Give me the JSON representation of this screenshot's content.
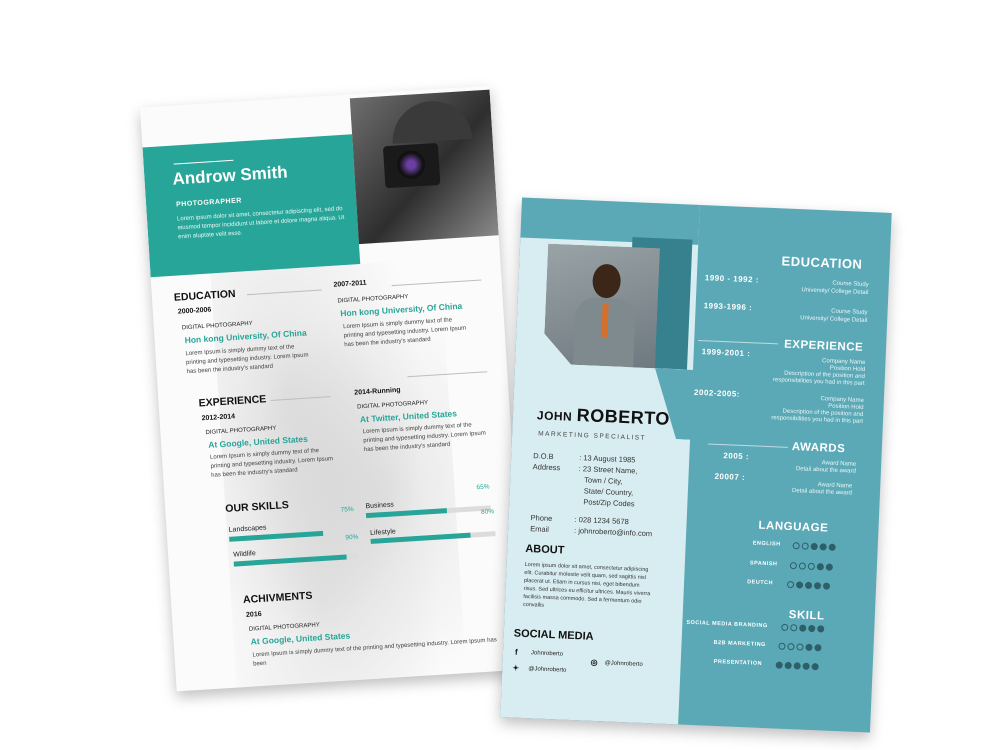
{
  "left": {
    "name": "Androw Smith",
    "role": "PHOTOGRAPHER",
    "intro": "Lorem ipsum dolor sit amet, consectetur adipiscing elit, sed do eiusmod tempor incididunt ut labore et dolore magna aliqua. Ut enim aluptate velit esse.",
    "education_heading": "EDUCATION",
    "education": [
      {
        "years": "2000-2006",
        "sub": "DIGITAL PHOTOGRAPHY",
        "place": "Hon kong University, Of China",
        "text": "Lorem Ipsum is simply dummy text of the printing and typesetting industry. Lorem Ipsum has been the industry's standard"
      },
      {
        "years": "2007-2011",
        "sub": "DIGITAL PHOTOGRAPHY",
        "place": "Hon kong University, Of China",
        "text": "Lorem Ipsum is simply dummy text of the printing and typesetting industry. Lorem Ipsum has been the industry's standard"
      }
    ],
    "experience_heading": "EXPERIENCE",
    "experience": [
      {
        "years": "2012-2014",
        "sub": "DIGITAL PHOTOGRAPHY",
        "place": "At Google, United States",
        "text": "Lorem Ipsum is simply dummy text of the printing and typesetting industry. Lorem Ipsum has been the industry's standard"
      },
      {
        "years": "2014-Running",
        "sub": "DIGITAL PHOTOGRAPHY",
        "place": "At Twitter, United States",
        "text": "Lorem Ipsum is simply dummy text of the printing and typesetting industry. Lorem Ipsum has been the industry's standard"
      }
    ],
    "skills_heading": "OUR SKILLS",
    "skills": [
      {
        "label": "Landscapes",
        "pct": "75%",
        "level": 0.75
      },
      {
        "label": "Business",
        "pct": "65%",
        "level": 0.65
      },
      {
        "label": "Wildlife",
        "pct": "90%",
        "level": 0.9
      },
      {
        "label": "Lifestyle",
        "pct": "80%",
        "level": 0.8
      }
    ],
    "achievements_heading": "ACHIVMENTS",
    "achievement": {
      "years": "2016",
      "sub": "DIGITAL PHOTOGRAPHY",
      "place": "At Google, United States",
      "text": "Lorem Ipsum is simply dummy text of the printing and typesetting industry. Lorem Ipsum has been"
    }
  },
  "right": {
    "first_name": "JOHN",
    "last_name": "ROBERTO",
    "role": "MARKETING SPECIALIST",
    "info": [
      {
        "key": "D.O.B",
        "value": ": 13 August 1985"
      },
      {
        "key": "Address",
        "value": ": 23 Street Name,"
      },
      {
        "key": "",
        "value": "Town / City,"
      },
      {
        "key": "",
        "value": "State/ Country,"
      },
      {
        "key": "",
        "value": "Post/Zip Codes"
      },
      {
        "key": "Phone",
        "value": ": 028 1234 5678"
      },
      {
        "key": "Email",
        "value": ": johnroberto@info.com"
      }
    ],
    "about_heading": "ABOUT",
    "about_text": "Lorem ipsum dolor sit amet, consectetur adipiscing elit. Curabitur molestie velit quam, sed sagittis nisl placerat ut. Etiam in cursus nisi, eget bibendum risus. Sed ultrices eu efficitur ultrices. Mauris viverra facilisis massa commodo. Sed a fermentum odio convallis",
    "social_heading": "SOCIAL MEDIA",
    "social": [
      {
        "icon": "facebook-icon",
        "glyph": "f",
        "handle": "Johnroberto"
      },
      {
        "icon": "instagram-icon",
        "glyph": "◎",
        "handle": "@Johnroberto"
      },
      {
        "icon": "twitter-icon",
        "glyph": "✦",
        "handle": "@Johnroberto"
      }
    ],
    "education_heading": "EDUCATION",
    "education": [
      {
        "years": "1990 - 1992 :",
        "line1": "Course Study",
        "line2": "University/ College Detail"
      },
      {
        "years": "1993-1996 :",
        "line1": "Course Study",
        "line2": "University/ College Detail"
      }
    ],
    "experience_heading": "EXPERIENCE",
    "experience": [
      {
        "years": "1999-2001 :",
        "lines": [
          "Company Name",
          "Position Hold",
          "Description of the position and",
          "responsibilities you had in this part"
        ]
      },
      {
        "years": "2002-2005:",
        "lines": [
          "Company Name",
          "Position Hold",
          "Description of the position and",
          "responsibilities you had in this part"
        ]
      }
    ],
    "awards_heading": "AWARDS",
    "awards": [
      {
        "years": "2005 :",
        "line1": "Award Name",
        "line2": "Detail about the award"
      },
      {
        "years": "20007 :",
        "line1": "Award Name",
        "line2": "Detail about the award"
      }
    ],
    "language_heading": "LANGUAGE",
    "languages": [
      {
        "label": "ENGLISH",
        "filled": 3,
        "total": 5
      },
      {
        "label": "SPANISH",
        "filled": 2,
        "total": 5
      },
      {
        "label": "DEUTCH",
        "filled": 4,
        "total": 5
      }
    ],
    "skill_heading": "SKILL",
    "skills": [
      {
        "label": "SOCIAL MEDIA BRANDING",
        "filled": 3,
        "total": 5
      },
      {
        "label": "B2B MARKETING",
        "filled": 2,
        "total": 5
      },
      {
        "label": "PRESENTATION",
        "filled": 5,
        "total": 5
      }
    ],
    "colors": {
      "panel": "#5ba9b6",
      "light": "#d8edf1",
      "dark": "#37808e"
    }
  }
}
